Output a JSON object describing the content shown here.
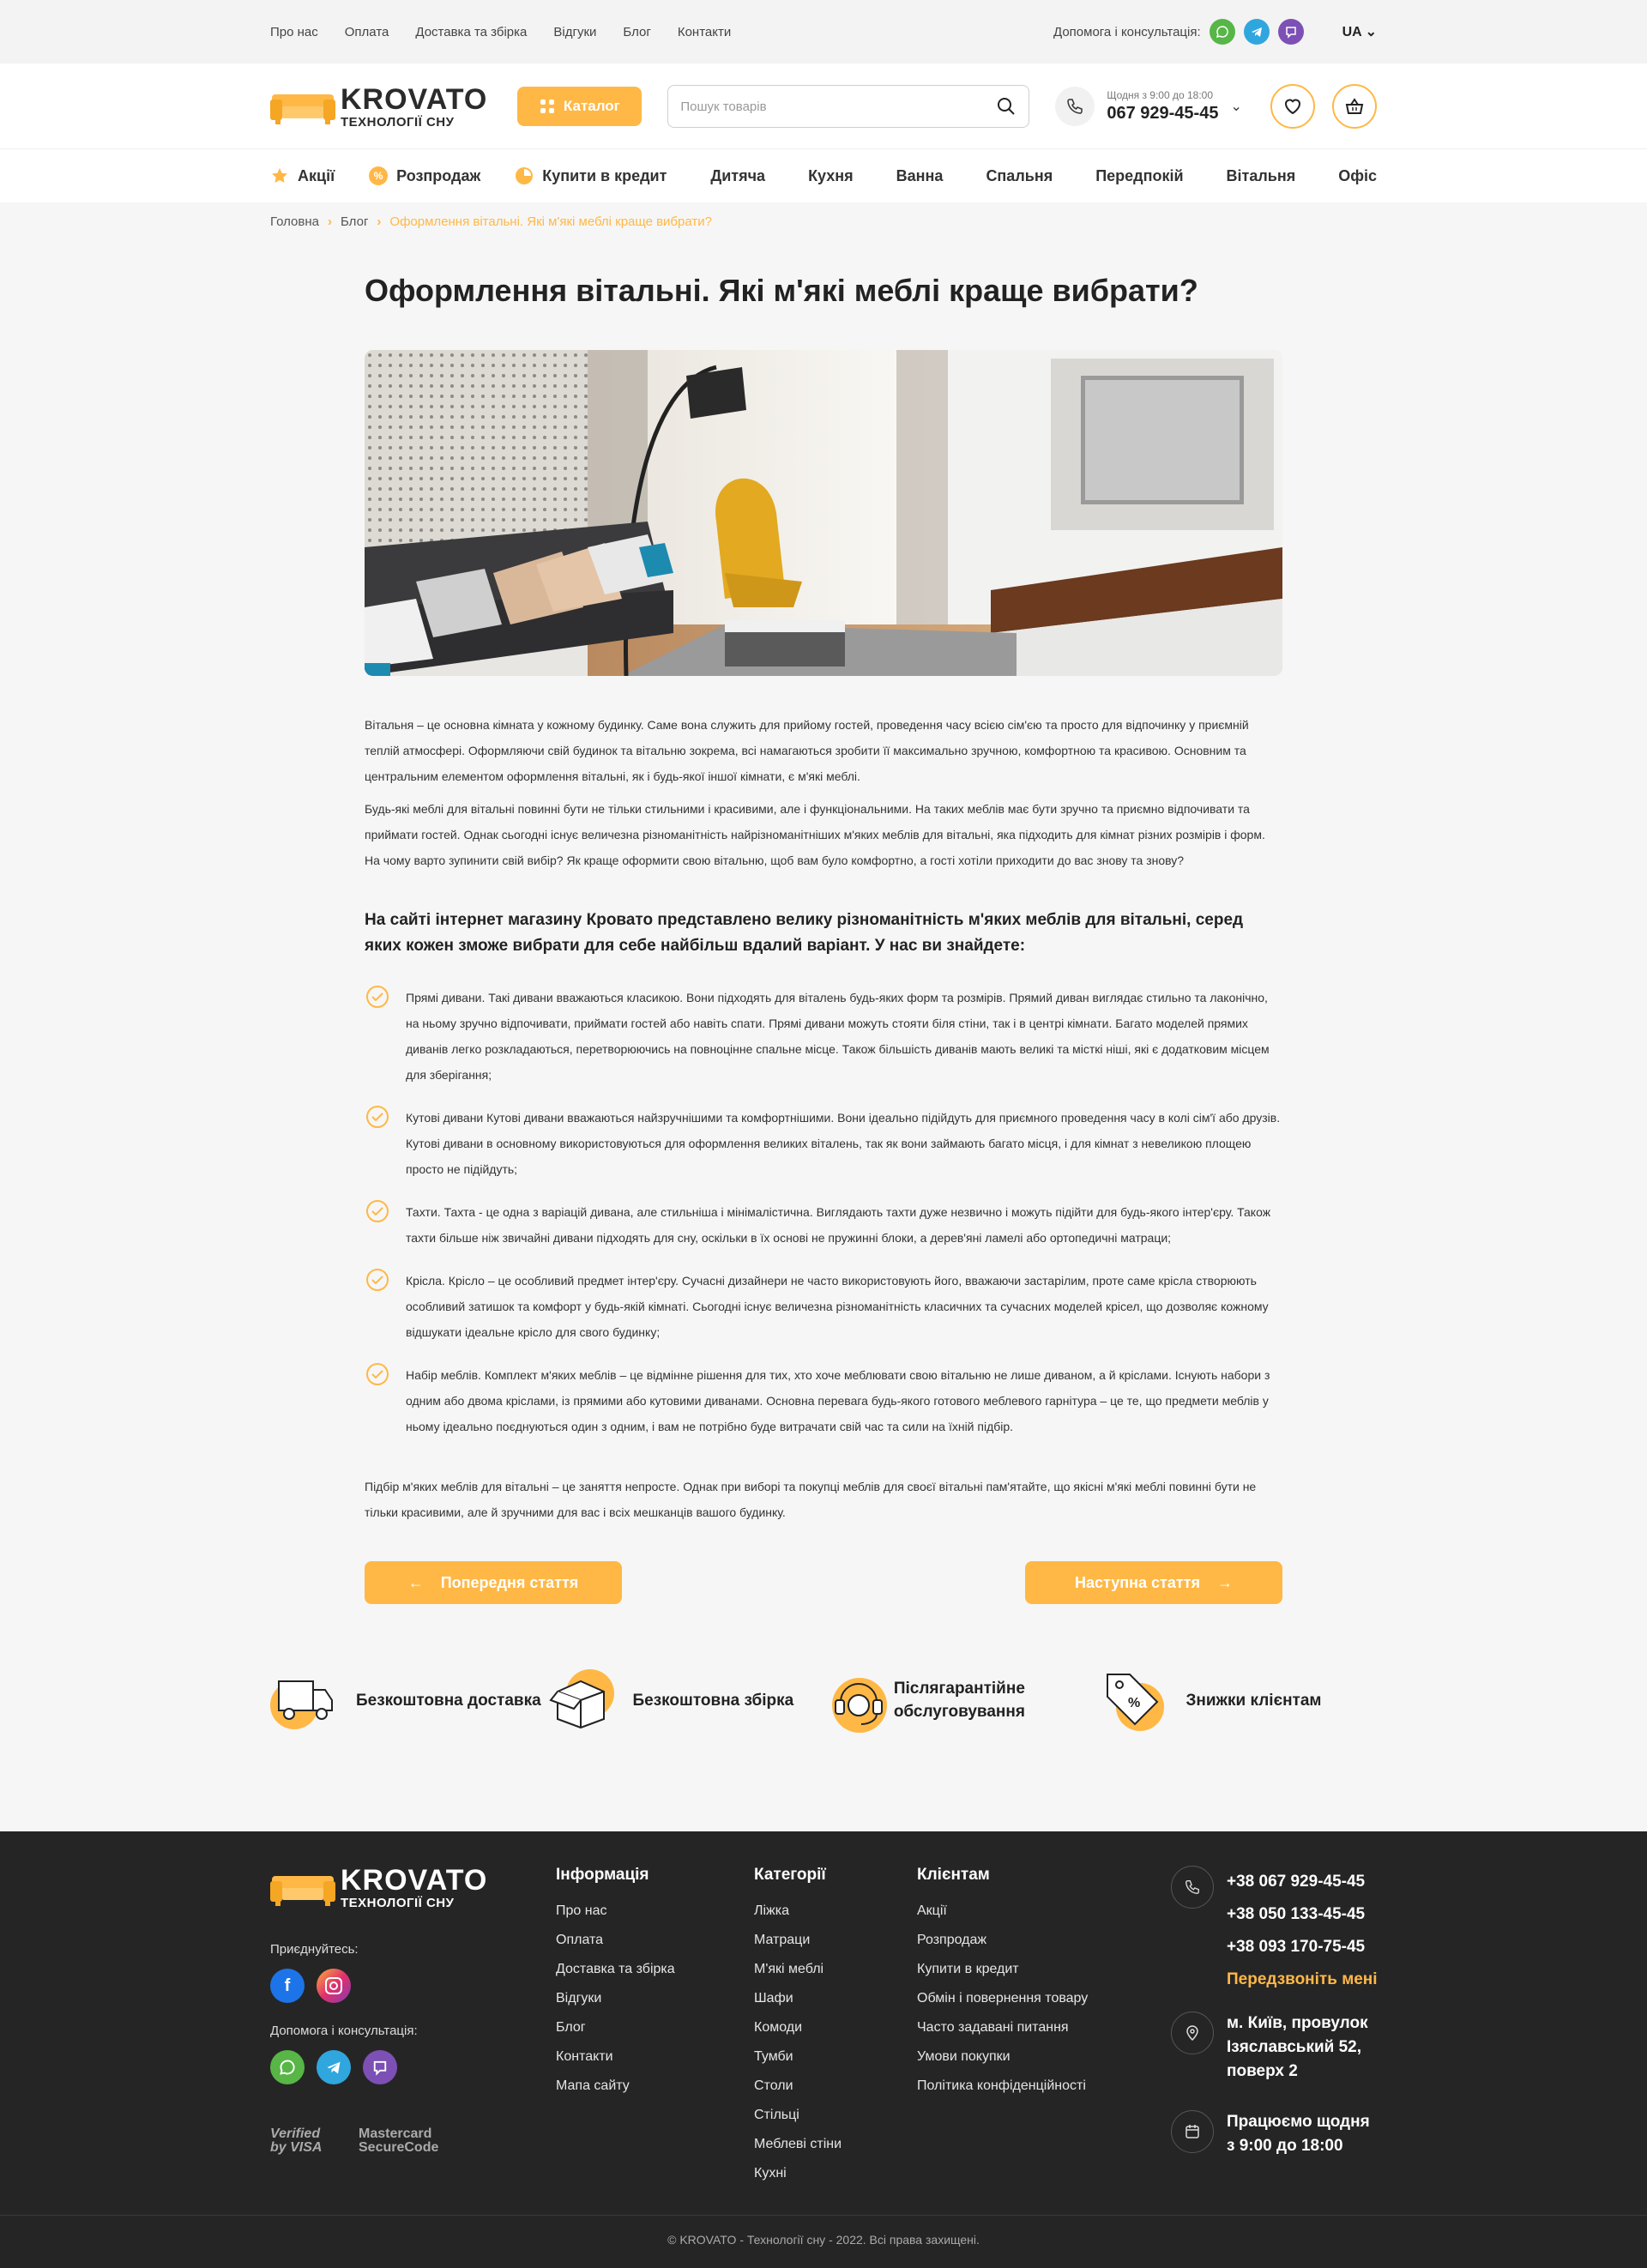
{
  "topbar": {
    "links": [
      "Про нас",
      "Оплата",
      "Доставка та збірка",
      "Відгуки",
      "Блог",
      "Контакти"
    ],
    "help_label": "Допомога і консультація:",
    "lang": "UA"
  },
  "header": {
    "logo_main": "KROVATO",
    "logo_sub": "ТЕХНОЛОГІЇ СНУ",
    "catalog_label": "Каталог",
    "search_placeholder": "Пошук товарів",
    "hours": "Щодня з 9:00 до 18:00",
    "phone": "067 929-45-45"
  },
  "nav": {
    "left": [
      "Акції",
      "Розпродаж",
      "Купити в кредит"
    ],
    "right": [
      "Дитяча",
      "Кухня",
      "Ванна",
      "Спальня",
      "Передпокій",
      "Вітальня",
      "Офіс"
    ]
  },
  "breadcrumb": [
    "Головна",
    "Блог",
    "Оформлення вітальні. Які м'які меблі краще вибрати?"
  ],
  "article": {
    "title": "Оформлення вітальні. Які м'які меблі краще вибрати?",
    "intro": [
      "Вітальня – це основна кімната у кожному будинку. Саме вона служить для прийому гостей, проведення часу всією сім'єю та просто для відпочинку у приємній теплій атмосфері. Оформляючи свій будинок та вітальню зокрема, всі намагаються зробити її максимально зручною, комфортною та красивою. Основним та центральним елементом оформлення вітальні, як і будь-якої іншої кімнати, є м'які меблі.",
      "Будь-які меблі для вітальні повинні бути не тільки стильними і красивими, але і функціональними. На таких меблів має бути зручно та приємно відпочивати та приймати гостей. Однак сьогодні існує величезна різноманітність найрізноманітніших м'яких меблів для вітальні, яка підходить для кімнат різних розмірів і форм. На чому варто зупинити свій вибір? Як краще оформити свою вітальню, щоб вам було комфортно, а гості хотіли приходити до вас знову та знову?"
    ],
    "subtitle": "На сайті інтернет магазину Кровато представлено велику різноманітність м'яких меблів для вітальні, серед яких кожен зможе вибрати для себе найбільш вдалий варіант. У нас ви знайдете:",
    "items": [
      "Прямі дивани. Такі дивани вважаються класикою. Вони підходять для віталень будь-яких форм та розмірів. Прямий диван виглядає стильно та лаконічно, на ньому зручно відпочивати, приймати гостей або навіть спати. Прямі дивани можуть стояти біля стіни, так і в центрі кімнати. Багато моделей прямих диванів легко розкладаються, перетворюючись на повноцінне спальне місце. Також більшість диванів мають великі та місткі ніші, які є додатковим місцем для зберігання;",
      "Кутові дивани Кутові дивани вважаються найзручнішими та комфортнішими. Вони ідеально підійдуть для приємного проведення часу в колі сім'ї або друзів. Кутові дивани в основному використовуються для оформлення великих віталень, так як вони займають багато місця, і для кімнат з невеликою площею просто не підійдуть;",
      "Тахти. Тахта - це одна з варіацій дивана, але стильніша і мінімалістична. Виглядають тахти дуже незвично і можуть підійти для будь-якого інтер'єру. Також тахти більше ніж звичайні дивани підходять для сну, оскільки в їх основі не пружинні блоки, а дерев'яні ламелі або ортопедичні матраци;",
      "Крісла. Крісло – це особливий предмет інтер'єру. Сучасні дизайнери не часто використовують його, вважаючи застарілим, проте саме крісла створюють особливий затишок та комфорт у будь-якій кімнаті. Сьогодні існує величезна різноманітність класичних та сучасних моделей крісел, що дозволяє кожному відшукати ідеальне крісло для свого будинку;",
      "Набір меблів. Комплект м'яких меблів – це відмінне рішення для тих, хто хоче меблювати свою вітальню не лише диваном, а й кріслами. Існують набори з одним або двома кріслами, із прямими або кутовими диванами. Основна перевага будь-якого готового меблевого гарнітура – це те, що предмети меблів у ньому ідеально поєднуються один з одним, і вам не потрібно буде витрачати свій час та сили на їхній підбір."
    ],
    "outro": "Підбір м'яких меблів для вітальні – це заняття непросте. Однак при виборі та покупці меблів для своєї вітальні пам'ятайте, що якісні м'які меблі повинні бути не тільки красивими, але й зручними для вас і всіх мешканців вашого будинку.",
    "prev_label": "Попередня стаття",
    "next_label": "Наступна стаття"
  },
  "benefits": [
    {
      "label": "Безкоштовна доставка",
      "icon": "truck-icon"
    },
    {
      "label": "Безкоштовна збірка",
      "icon": "box-icon"
    },
    {
      "label": "Післягарантійне обслуговування",
      "icon": "support-icon"
    },
    {
      "label": "Знижки клієнтам",
      "icon": "discount-tag-icon"
    }
  ],
  "footer": {
    "join_label": "Приєднуйтесь:",
    "help_label": "Допомога і консультація:",
    "pay": [
      "Verified by VISA",
      "Mastercard SecureCode"
    ],
    "info_title": "Інформація",
    "info_links": [
      "Про нас",
      "Оплата",
      "Доставка та збірка",
      "Відгуки",
      "Блог",
      "Контакти",
      "Мапа сайту"
    ],
    "cat_title": "Категорії",
    "cat_links": [
      "Ліжка",
      "Матраци",
      "М'які меблі",
      "Шафи",
      "Комоди",
      "Тумби",
      "Столи",
      "Стільці",
      "Меблеві стіни",
      "Кухні"
    ],
    "client_title": "Клієнтам",
    "client_links": [
      "Акції",
      "Розпродаж",
      "Купити в кредит",
      "Обмін і повернення товару",
      "Часто задавані питання",
      "Умови покупки",
      "Політика конфіденційності"
    ],
    "phones": [
      "+38 067 929-45-45",
      "+38 050 133-45-45",
      "+38 093 170-75-45"
    ],
    "callback": "Передзвоніть мені",
    "address": "м. Київ, провулок Ізяславський 52, поверх 2",
    "hours": "Працюємо щодня з 9:00 до 18:00",
    "copyright": "© KROVATO - Технології сну - 2022. Всі права захищені.",
    "accent": "#ffb846"
  }
}
